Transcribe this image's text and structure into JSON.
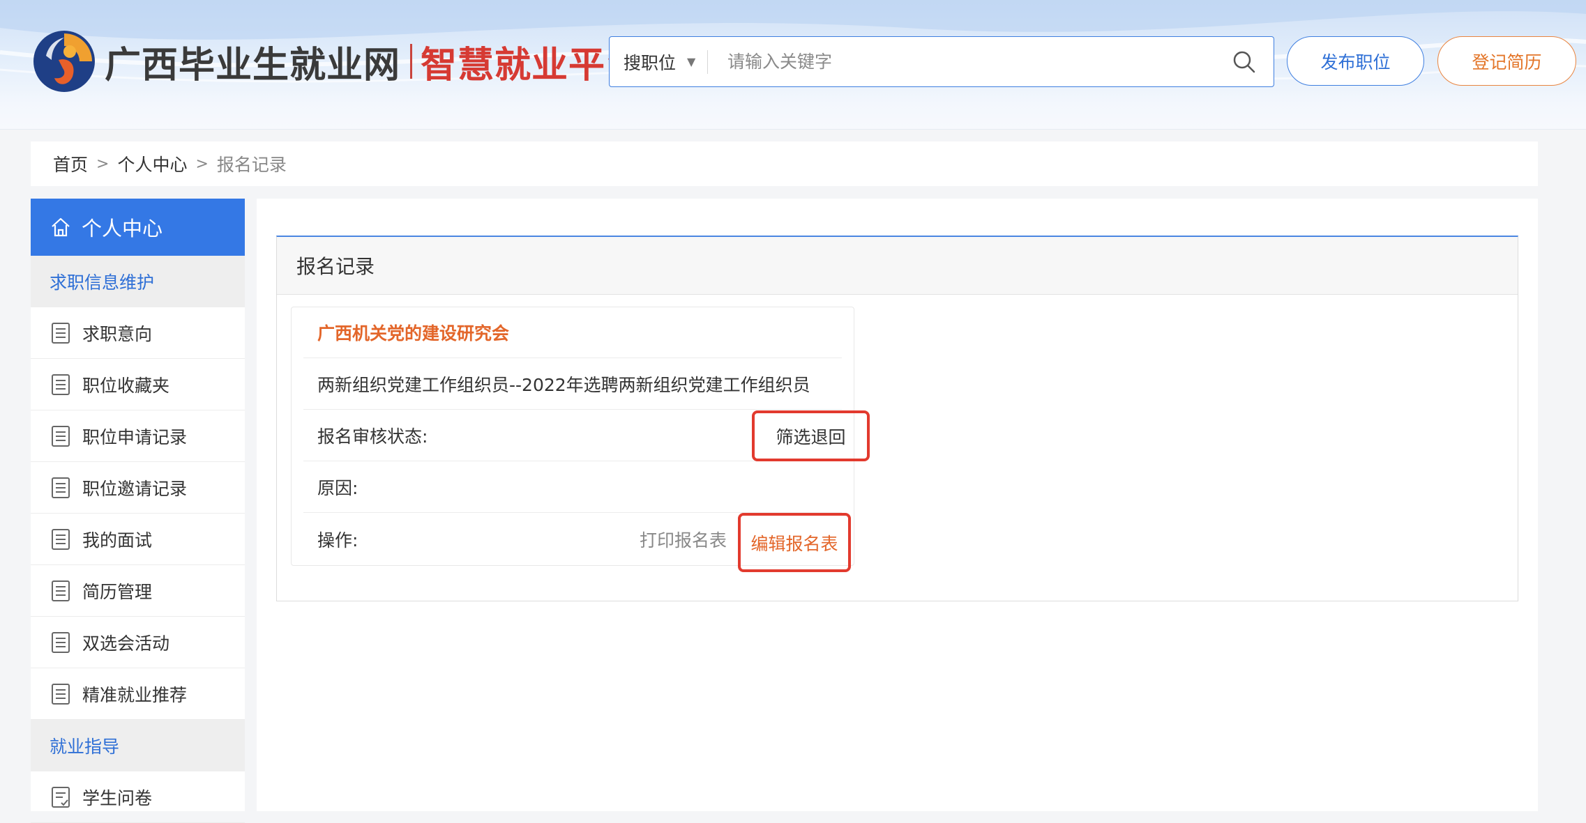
{
  "header": {
    "logo_main": "广西毕业生就业网",
    "logo_sub": "智慧就业平台",
    "search_type": "搜职位",
    "search_placeholder": "请输入关键字",
    "publish_label": "发布职位",
    "register_label": "登记简历"
  },
  "breadcrumb": [
    "首页",
    "个人中心",
    "报名记录"
  ],
  "sidebar": {
    "title": "个人中心",
    "groups": [
      {
        "label": "求职信息维护",
        "items": [
          "求职意向",
          "职位收藏夹",
          "职位申请记录",
          "职位邀请记录",
          "我的面试",
          "简历管理",
          "双选会活动",
          "精准就业推荐"
        ]
      },
      {
        "label": "就业指导",
        "items": [
          "学生问卷"
        ]
      }
    ]
  },
  "main": {
    "panel_title": "报名记录",
    "record": {
      "org": "广西机关党的建设研究会",
      "position": "两新组织党建工作组织员--2022年选聘两新组织党建工作组织员",
      "status_label": "报名审核状态:",
      "status_value": "筛选退回",
      "reason_label": "原因:",
      "reason_value": "",
      "ops_label": "操作:",
      "print_label": "打印报名表",
      "edit_label": "编辑报名表"
    }
  },
  "colors": {
    "brand_blue": "#3478e5",
    "accent_orange": "#e3662a",
    "highlight_red": "#e23a2e"
  }
}
